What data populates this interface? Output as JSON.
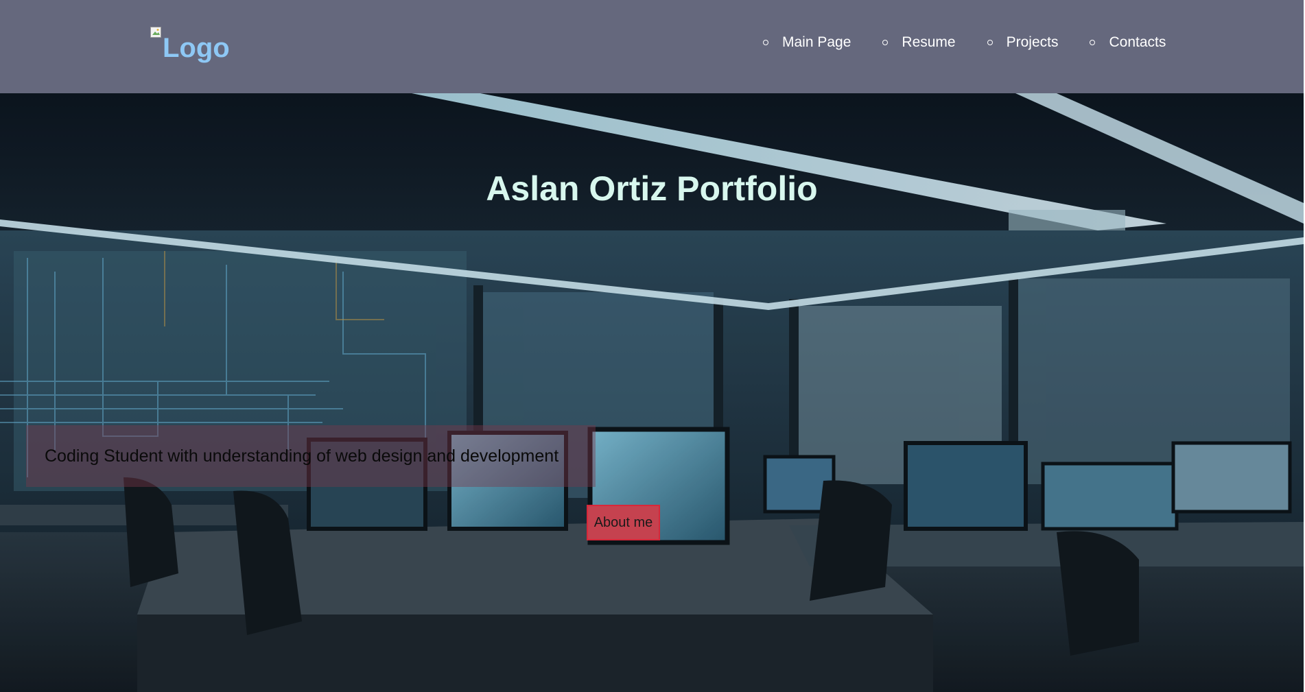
{
  "header": {
    "logo_alt": "Logo",
    "nav": [
      {
        "label": "Main Page"
      },
      {
        "label": "Resume"
      },
      {
        "label": "Projects"
      },
      {
        "label": "Contacts"
      }
    ]
  },
  "hero": {
    "title": "Aslan Ortiz Portfolio",
    "tagline": "Coding Student with understanding of web design and development",
    "button_label": "About me"
  },
  "icons": {
    "logo": "broken-image-icon",
    "nav_bullet": "circle-bullet-icon"
  },
  "colors": {
    "header_bg": "#65687d",
    "logo_text": "#8ec8f5",
    "title_text": "#d8f7ee",
    "button_bg": "#c5424f",
    "tagline_box": "rgba(125,55,75,0.42)"
  }
}
